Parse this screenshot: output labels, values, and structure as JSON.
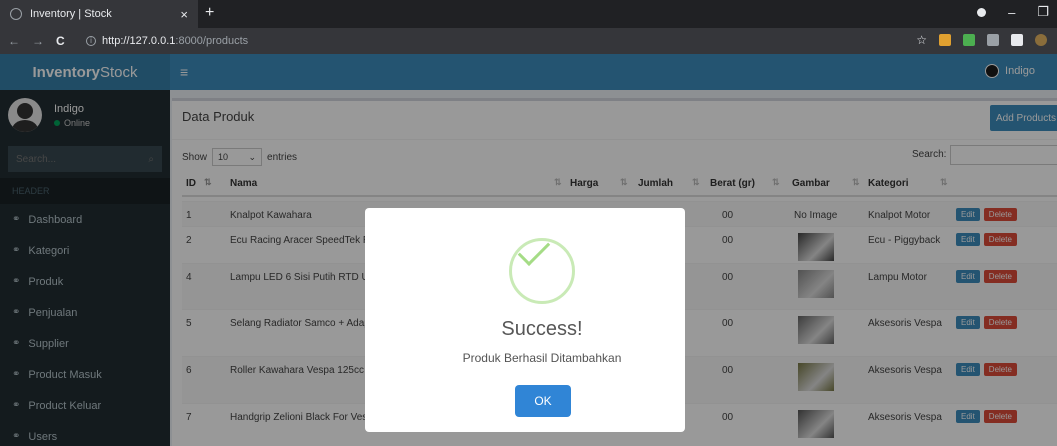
{
  "browser": {
    "tab_title": "Inventory | Stock",
    "tab_close": "×",
    "new_tab": "+",
    "url_host": "http://127.0.0.1",
    "url_path": ":8000/products",
    "back": "←",
    "forward": "→",
    "reload": "C",
    "star": "☆",
    "minimize": "–",
    "restore": "❐"
  },
  "header": {
    "logo_bold": "Inventory",
    "logo_light": "Stock",
    "menu_toggle": "≡",
    "user_name": "Indigo"
  },
  "sidebar": {
    "user_name": "Indigo",
    "status": "Online",
    "search_placeholder": "Search...",
    "search_icon": "⌕",
    "section_header": "HEADER",
    "items": [
      {
        "label": "Dashboard",
        "icon": "link-icon"
      },
      {
        "label": "Kategori",
        "icon": "link-icon"
      },
      {
        "label": "Produk",
        "icon": "link-icon"
      },
      {
        "label": "Penjualan",
        "icon": "link-icon"
      },
      {
        "label": "Supplier",
        "icon": "link-icon"
      },
      {
        "label": "Product Masuk",
        "icon": "link-icon"
      },
      {
        "label": "Product Keluar",
        "icon": "link-icon"
      },
      {
        "label": "Users",
        "icon": "link-icon"
      }
    ]
  },
  "main": {
    "title": "Data Produk",
    "add_button": "Add Products",
    "show_label": "Show",
    "entries_value": "10",
    "entries_label": "entries",
    "search_label": "Search:",
    "columns": [
      "ID",
      "Nama",
      "Harga",
      "Jumlah",
      "Berat (gr)",
      "Gambar",
      "Kategori"
    ],
    "rows": [
      {
        "id": "1",
        "nama": "Knalpot Kawahara",
        "berat": "00",
        "gambar": "No Image",
        "kategori": "Knalpot Motor"
      },
      {
        "id": "2",
        "nama": "Ecu Racing Aracer SpeedTek RC M",
        "berat": "00",
        "gambar": "",
        "kategori": "Ecu - Piggyback"
      },
      {
        "id": "4",
        "nama": "Lampu LED 6 Sisi Putih RTD Unive",
        "berat": "00",
        "gambar": "",
        "kategori": "Lampu Motor"
      },
      {
        "id": "5",
        "nama": "Selang Radiator Samco + Adaptor",
        "berat": "00",
        "gambar": "",
        "kategori": "Aksesoris Vespa"
      },
      {
        "id": "6",
        "nama": "Roller Kawahara Vespa 125cc Mix",
        "berat": "00",
        "gambar": "",
        "kategori": "Aksesoris Vespa"
      },
      {
        "id": "7",
        "nama": "Handgrip Zelioni Black For Vespa",
        "berat": "00",
        "gambar": "",
        "kategori": "Aksesoris Vespa"
      }
    ],
    "edit_label": "Edit",
    "delete_label": "Delete"
  },
  "modal": {
    "title": "Success!",
    "message": "Produk Berhasil Ditambahkan",
    "ok": "OK"
  },
  "colors": {
    "brand": "#3c8dbc",
    "sidebar": "#222d32",
    "success": "#a5dc86",
    "danger": "#dd4b39"
  }
}
